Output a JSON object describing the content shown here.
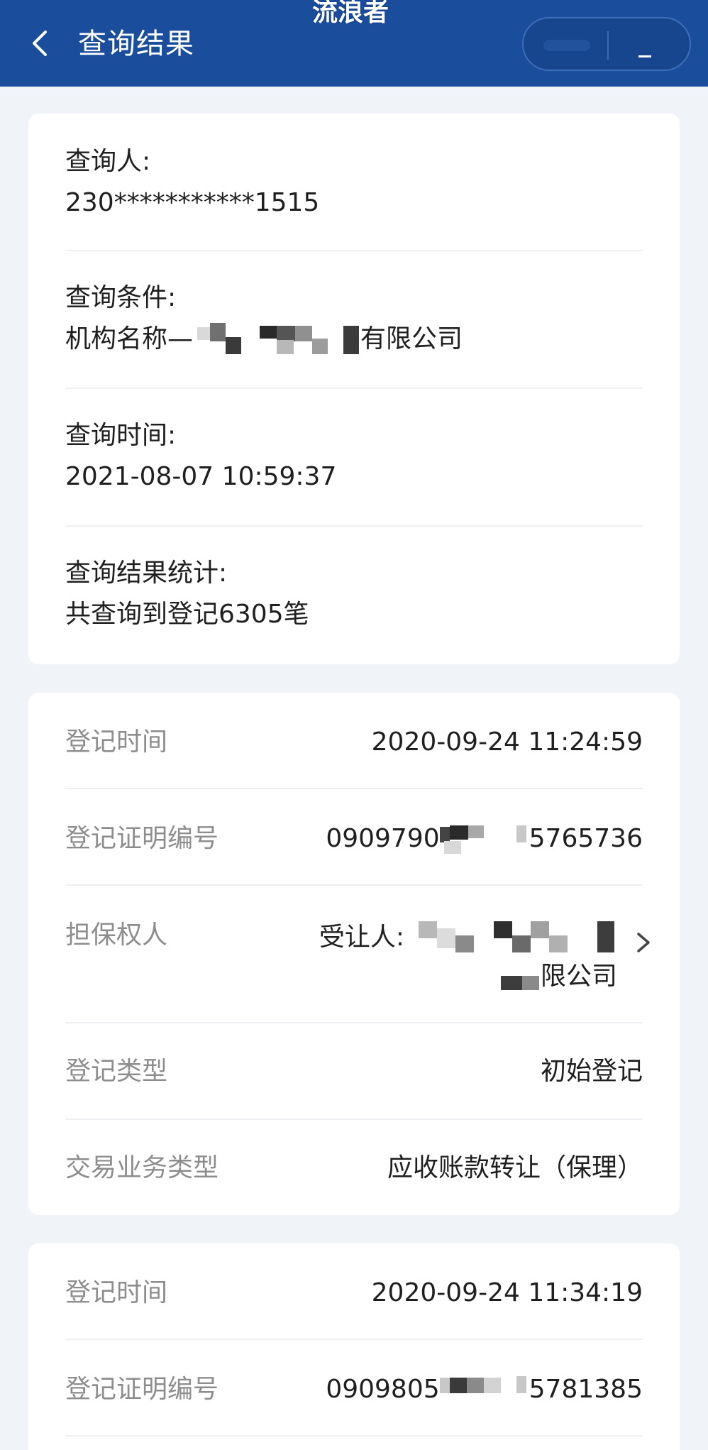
{
  "header": {
    "title": "查询结果",
    "watermark": "流浪者"
  },
  "query_info": {
    "querier": {
      "label": "查询人:",
      "value": "230***********1515"
    },
    "condition": {
      "label": "查询条件:",
      "prefix": "机构名称—",
      "suffix": "有限公司"
    },
    "time": {
      "label": "查询时间:",
      "value": "2021-08-07 10:59:37"
    },
    "stats": {
      "label": "查询结果统计:",
      "value": "共查询到登记6305笔"
    }
  },
  "records": [
    {
      "reg_time_label": "登记时间",
      "reg_time_value": "2020-09-24 11:24:59",
      "cert_no_label": "登记证明编号",
      "cert_no_prefix": "0909790",
      "cert_no_suffix": "5765736",
      "secured_party_label": "担保权人",
      "secured_party_prefix": "受让人:",
      "secured_party_suffix": "限公司",
      "reg_type_label": "登记类型",
      "reg_type_value": "初始登记",
      "biz_type_label": "交易业务类型",
      "biz_type_value": "应收账款转让（保理）"
    },
    {
      "reg_time_label": "登记时间",
      "reg_time_value": "2020-09-24 11:34:19",
      "cert_no_label": "登记证明编号",
      "cert_no_prefix": "0909805",
      "cert_no_suffix": "5781385"
    }
  ],
  "colors": {
    "header_bg": "#1a4d9c",
    "page_bg": "#f0f3f8",
    "label_gray": "#8d8d8d",
    "text_dark": "#1f1f1f"
  }
}
